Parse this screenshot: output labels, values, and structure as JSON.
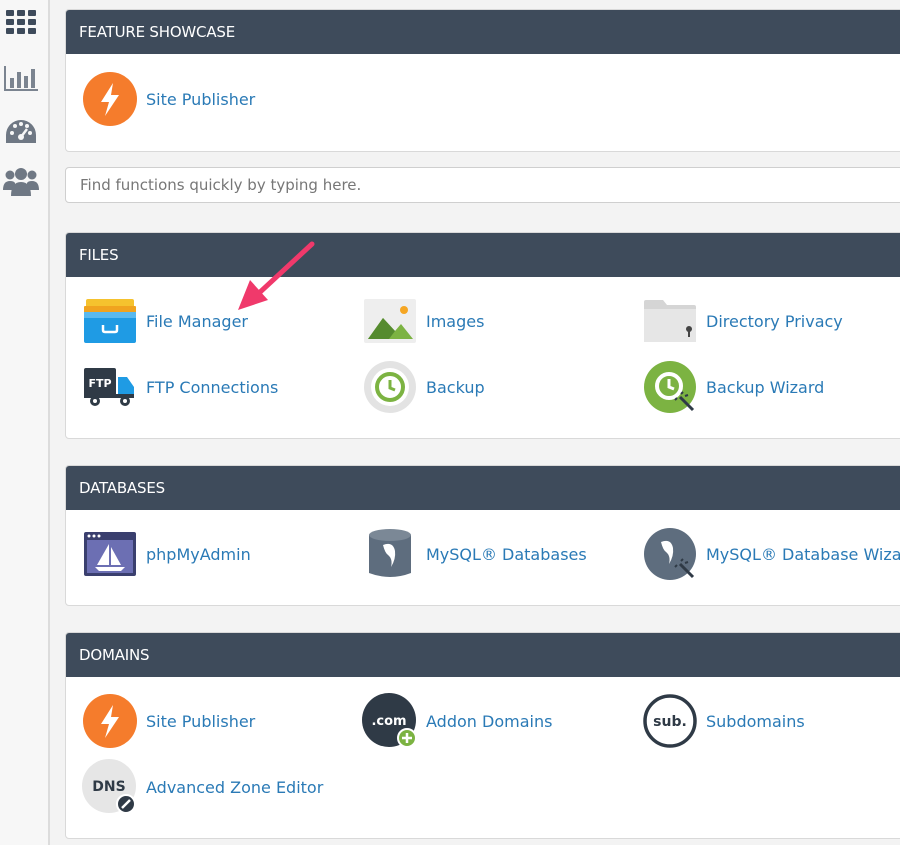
{
  "sidebar": {
    "items": [
      {
        "icon": "grid-icon"
      },
      {
        "icon": "bar-chart-icon"
      },
      {
        "icon": "gauge-icon"
      },
      {
        "icon": "users-icon"
      }
    ]
  },
  "feature_showcase": {
    "title": "FEATURE SHOWCASE",
    "items": [
      {
        "label": "Site Publisher",
        "icon": "site-publisher-icon"
      }
    ]
  },
  "search": {
    "placeholder": "Find functions quickly by typing here."
  },
  "files": {
    "title": "FILES",
    "items": [
      {
        "label": "File Manager",
        "icon": "file-manager-icon"
      },
      {
        "label": "Images",
        "icon": "images-icon"
      },
      {
        "label": "Directory Privacy",
        "icon": "directory-privacy-icon"
      },
      {
        "label": "FTP Connections",
        "icon": "ftp-connections-icon"
      },
      {
        "label": "Backup",
        "icon": "backup-icon"
      },
      {
        "label": "Backup Wizard",
        "icon": "backup-wizard-icon"
      }
    ]
  },
  "databases": {
    "title": "DATABASES",
    "items": [
      {
        "label": "phpMyAdmin",
        "icon": "phpmyadmin-icon"
      },
      {
        "label": "MySQL® Databases",
        "icon": "mysql-databases-icon"
      },
      {
        "label": "MySQL® Database Wizard",
        "icon": "mysql-database-wizard-icon"
      }
    ]
  },
  "domains": {
    "title": "DOMAINS",
    "items": [
      {
        "label": "Site Publisher",
        "icon": "site-publisher-icon"
      },
      {
        "label": "Addon Domains",
        "icon": "addon-domains-icon",
        "icon_text": ".com"
      },
      {
        "label": "Subdomains",
        "icon": "subdomains-icon",
        "icon_text": "sub."
      },
      {
        "label": "Advanced Zone Editor",
        "icon": "dns-icon",
        "icon_text": "DNS"
      }
    ]
  },
  "ftp_icon_text": "FTP",
  "colors": {
    "header_bg": "#3e4b5b",
    "link": "#2a7ab6",
    "accent_orange": "#f57c2c",
    "arrow_pink": "#f0396b"
  }
}
